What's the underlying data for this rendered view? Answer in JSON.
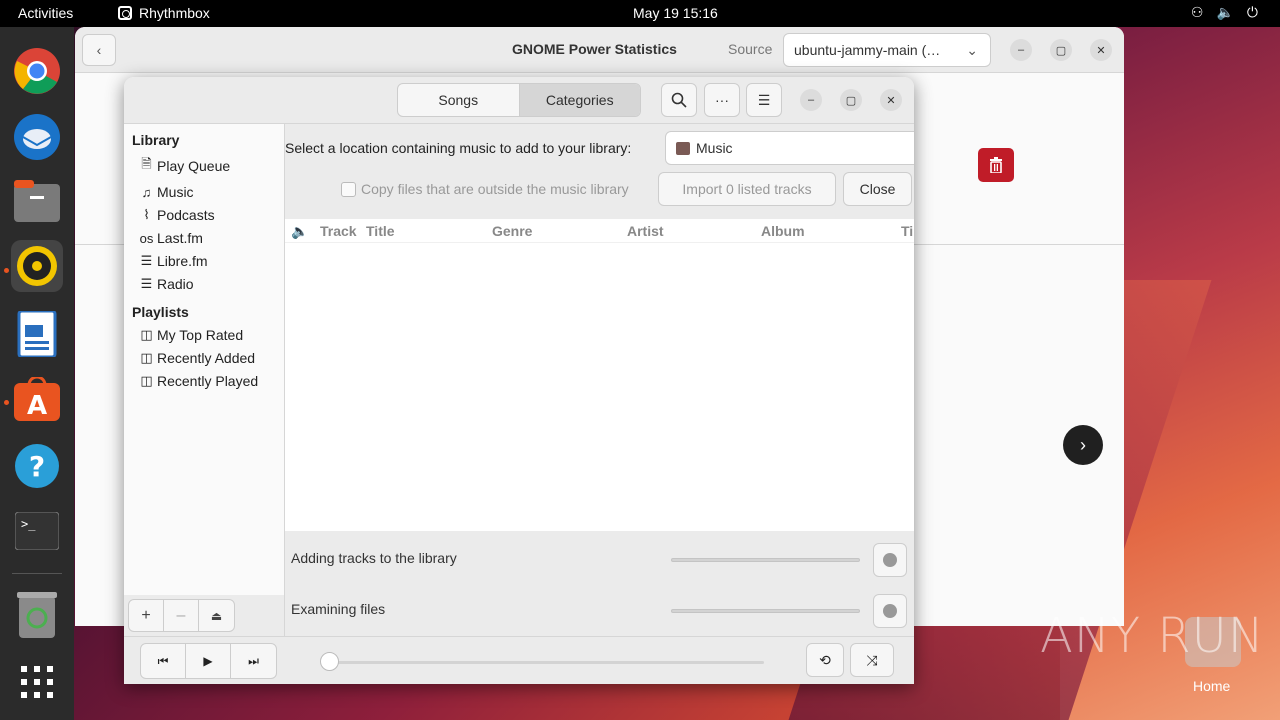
{
  "topbar": {
    "activities": "Activities",
    "app_name": "Rhythmbox",
    "clock": "May 19  15:16",
    "tray_icons": [
      "network-icon",
      "volume-icon",
      "power-icon"
    ]
  },
  "dock": {
    "apps": [
      "chrome-icon",
      "thunderbird-icon",
      "files-icon",
      "rhythmbox-icon",
      "writer-icon",
      "app-center-icon",
      "help-icon",
      "terminal-icon",
      "trash-icon",
      "app-grid-icon"
    ]
  },
  "power_window": {
    "title": "GNOME Power Statistics",
    "source_label": "Source",
    "source_value": "ubuntu-jammy-main (…"
  },
  "rhythmbox": {
    "tabs": [
      "Songs",
      "Categories"
    ],
    "active_tab": "Categories",
    "sidebar": {
      "library_heading": "Library",
      "library_items": [
        "Play Queue",
        "Music",
        "Podcasts",
        "Last.fm",
        "Libre.fm",
        "Radio"
      ],
      "playlists_heading": "Playlists",
      "playlist_items": [
        "My Top Rated",
        "Recently Added",
        "Recently Played"
      ]
    },
    "import": {
      "location_label": "Select a location containing music to add to your library:",
      "location_value": "Music",
      "copy_checkbox_label": "Copy files that are outside the music library",
      "copy_checked": false,
      "import_button": "Import 0 listed tracks",
      "close_button": "Close"
    },
    "columns": [
      "Track",
      "Title",
      "Genre",
      "Artist",
      "Album",
      "Ti"
    ],
    "progress": [
      {
        "label": "Adding tracks to the library",
        "value": 0
      },
      {
        "label": "Examining files",
        "value": 0
      }
    ],
    "playback_position": 0
  },
  "desktop": {
    "watermark": "ANY RUN",
    "home_label": "Home"
  },
  "colors": {
    "accent_orange": "#e95420",
    "delete_red": "#c01c28"
  }
}
